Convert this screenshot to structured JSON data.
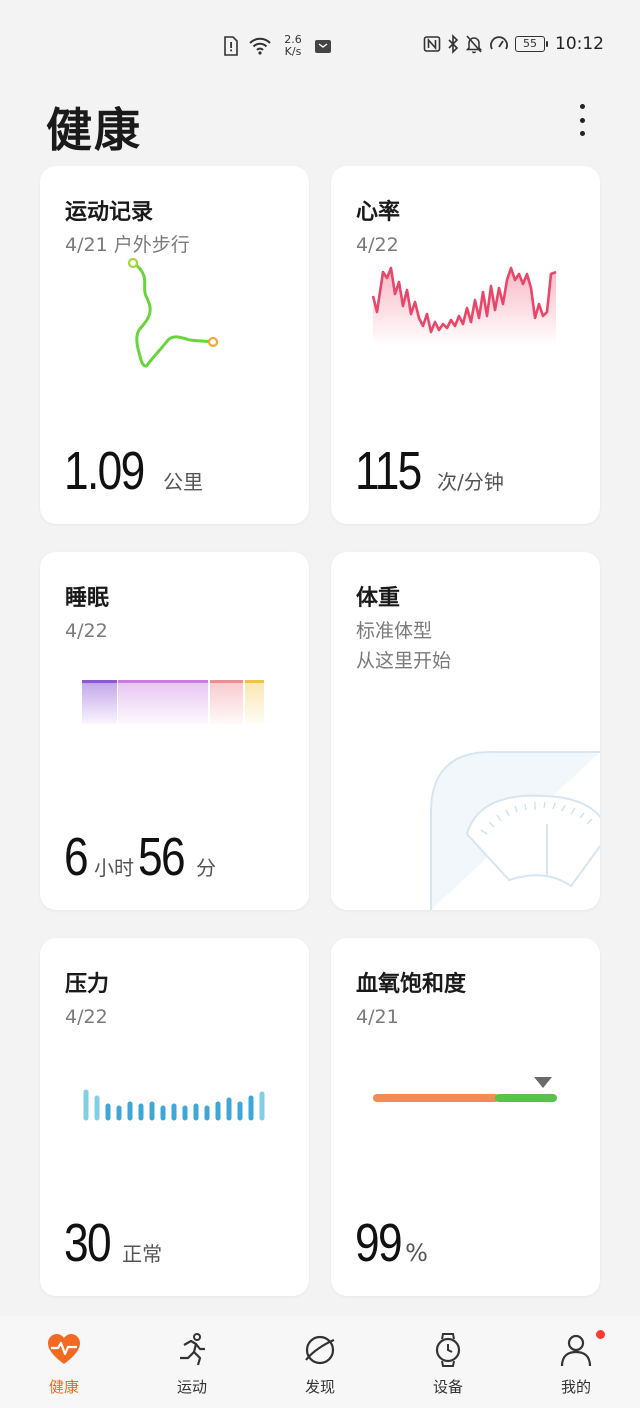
{
  "status": {
    "speed_value": "2.6",
    "speed_unit": "K/s",
    "battery": "55",
    "time": "10:12"
  },
  "header": {
    "title": "健康"
  },
  "cards": {
    "exercise": {
      "title": "运动记录",
      "sub": "4/21 户外步行",
      "value": "1.09",
      "unit": "公里"
    },
    "heart": {
      "title": "心率",
      "sub": "4/22",
      "value": "115",
      "unit": "次/分钟"
    },
    "sleep": {
      "title": "睡眠",
      "sub": "4/22",
      "hours": "6",
      "hours_unit": "小时",
      "minutes": "56",
      "minutes_unit": "分"
    },
    "weight": {
      "title": "体重",
      "sub1": "标准体型",
      "sub2": "从这里开始"
    },
    "stress": {
      "title": "压力",
      "sub": "4/22",
      "value": "30",
      "unit": "正常"
    },
    "spo2": {
      "title": "血氧饱和度",
      "sub": "4/21",
      "value": "99",
      "unit": "%"
    }
  },
  "tabs": [
    {
      "label": "健康",
      "icon": "heart-pulse-icon",
      "active": true
    },
    {
      "label": "运动",
      "icon": "running-icon"
    },
    {
      "label": "发现",
      "icon": "planet-icon"
    },
    {
      "label": "设备",
      "icon": "watch-icon"
    },
    {
      "label": "我的",
      "icon": "person-icon",
      "badge": true
    }
  ],
  "colors": {
    "accent": "#f26a21",
    "heart_line": "#e8476a",
    "route": "#6ad43c",
    "stress_bar": "#3fa6d8",
    "spo2_orange": "#f58a55",
    "spo2_green": "#5cc04e"
  }
}
